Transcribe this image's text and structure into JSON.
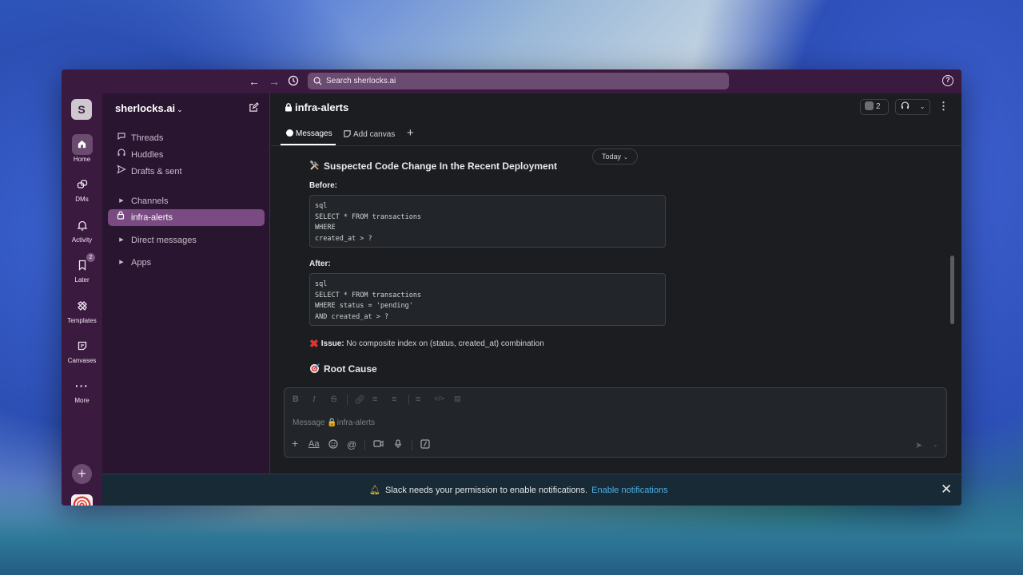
{
  "topbar": {
    "search_placeholder": "Search sherlocks.ai",
    "help_label": "?"
  },
  "rail": {
    "workspace_initial": "S",
    "items": [
      {
        "label": "Home",
        "icon": "home-icon"
      },
      {
        "label": "DMs",
        "icon": "dms-icon"
      },
      {
        "label": "Activity",
        "icon": "bell-icon"
      },
      {
        "label": "Later",
        "icon": "bookmark-icon",
        "badge": "2"
      },
      {
        "label": "Templates",
        "icon": "templates-icon"
      },
      {
        "label": "Canvases",
        "icon": "canvas-icon"
      },
      {
        "label": "More",
        "icon": "more-icon"
      }
    ],
    "add_label": "+"
  },
  "sidebar": {
    "workspace_name": "sherlocks.ai",
    "items": [
      {
        "label": "Threads",
        "icon": "threads-icon"
      },
      {
        "label": "Huddles",
        "icon": "headphones-icon"
      },
      {
        "label": "Drafts & sent",
        "icon": "send-icon"
      }
    ],
    "channels_label": "Channels",
    "active_channel": "infra-alerts",
    "direct_messages_label": "Direct messages",
    "apps_label": "Apps"
  },
  "channel": {
    "name": "infra-alerts",
    "member_count": "2",
    "tabs": [
      {
        "label": "Messages"
      },
      {
        "label": "Add canvas"
      }
    ],
    "add_tab": "+"
  },
  "messages": {
    "date_pill": "Today",
    "heading": "Suspected Code Change In the Recent Deployment",
    "before_label": "Before:",
    "before_code": "sql\nSELECT * FROM transactions\nWHERE\ncreated_at > ?",
    "after_label": "After:",
    "after_code": "sql\nSELECT * FROM transactions\nWHERE status = 'pending'\nAND created_at > ?",
    "issue_label": "Issue:",
    "issue_text": "No composite index on (status, created_at) combination",
    "root_cause_heading": "Root Cause"
  },
  "composer": {
    "placeholder": "Message 🔒infra-alerts",
    "aa_label": "Aa",
    "at_label": "@"
  },
  "notification": {
    "text": "Slack needs your permission to enable notifications.",
    "link": "Enable notifications",
    "close": "✕"
  },
  "colors": {
    "aubergine": "#3b1a3f",
    "sidebar": "#2a1530",
    "active_item": "#7a4a82",
    "main_bg": "#1b1d21",
    "link": "#4fb0e6",
    "error": "#e0352f"
  }
}
